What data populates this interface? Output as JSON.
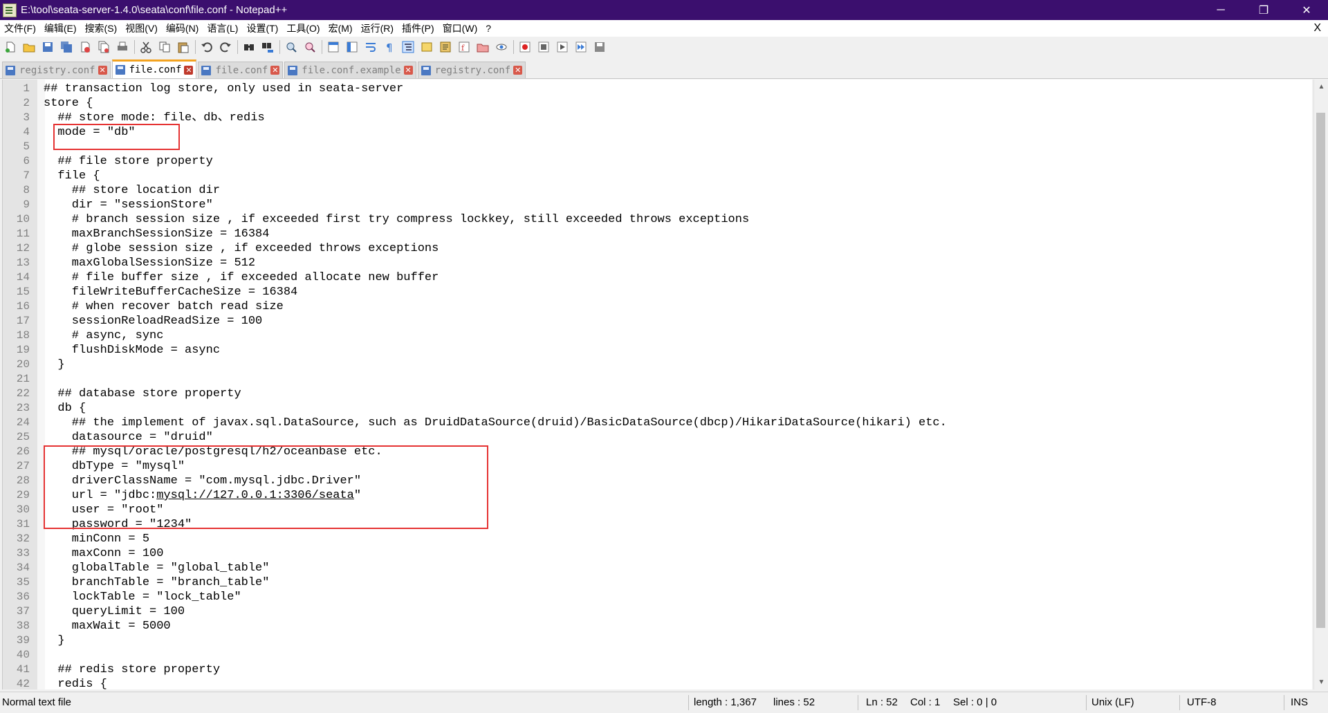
{
  "window": {
    "title": "E:\\tool\\seata-server-1.4.0\\seata\\conf\\file.conf - Notepad++",
    "minimize": "─",
    "restore": "❐",
    "close": "✕"
  },
  "menu": {
    "items": [
      "文件(F)",
      "编辑(E)",
      "搜索(S)",
      "视图(V)",
      "编码(N)",
      "语言(L)",
      "设置(T)",
      "工具(O)",
      "宏(M)",
      "运行(R)",
      "插件(P)",
      "窗口(W)",
      "?"
    ],
    "close": "X"
  },
  "toolbar": {
    "icons": [
      "new-file-icon",
      "open-file-icon",
      "save-icon",
      "save-all-icon",
      "close-icon",
      "close-all-icon",
      "print-icon",
      "cut-icon",
      "copy-icon",
      "paste-icon",
      "undo-icon",
      "redo-icon",
      "find-icon",
      "replace-icon",
      "zoom-in-icon",
      "zoom-out-icon",
      "sync-vertical-icon",
      "sync-horizontal-icon",
      "word-wrap-icon",
      "show-all-chars-icon",
      "indent-guide-icon",
      "udl-icon",
      "doc-map-icon",
      "function-list-icon",
      "folder-workspace-icon",
      "monitor-icon",
      "record-macro-icon",
      "stop-record-icon",
      "play-macro-icon",
      "run-macro-multiple-icon",
      "save-macro-icon"
    ]
  },
  "tabs": [
    {
      "label": "registry.conf",
      "active": false
    },
    {
      "label": "file.conf",
      "active": true
    },
    {
      "label": "file.conf",
      "active": false
    },
    {
      "label": "file.conf.example",
      "active": false
    },
    {
      "label": "registry.conf",
      "active": false
    }
  ],
  "editor": {
    "lines": [
      "## transaction log store, only used in seata-server",
      "store {",
      "  ## store mode: file、db、redis",
      "  mode = \"db\"",
      "",
      "  ## file store property",
      "  file {",
      "    ## store location dir",
      "    dir = \"sessionStore\"",
      "    # branch session size , if exceeded first try compress lockkey, still exceeded throws exceptions",
      "    maxBranchSessionSize = 16384",
      "    # globe session size , if exceeded throws exceptions",
      "    maxGlobalSessionSize = 512",
      "    # file buffer size , if exceeded allocate new buffer",
      "    fileWriteBufferCacheSize = 16384",
      "    # when recover batch read size",
      "    sessionReloadReadSize = 100",
      "    # async, sync",
      "    flushDiskMode = async",
      "  }",
      "",
      "  ## database store property",
      "  db {",
      "    ## the implement of javax.sql.DataSource, such as DruidDataSource(druid)/BasicDataSource(dbcp)/HikariDataSource(hikari) etc.",
      "    datasource = \"druid\"",
      "    ## mysql/oracle/postgresql/h2/oceanbase etc.",
      "    dbType = \"mysql\"",
      "    driverClassName = \"com.mysql.jdbc.Driver\"",
      "    url = \"jdbc:mysql://127.0.0.1:3306/seata\"",
      "    user = \"root\"",
      "    password = \"1234\"",
      "    minConn = 5",
      "    maxConn = 100",
      "    globalTable = \"global_table\"",
      "    branchTable = \"branch_table\"",
      "    lockTable = \"lock_table\"",
      "    queryLimit = 100",
      "    maxWait = 5000",
      "  }",
      "",
      "  ## redis store property",
      "  redis {"
    ],
    "url_prefix": "    url = \"jdbc:",
    "url_link": "mysql://127.0.0.1:3306/seata",
    "url_suffix": "\""
  },
  "status": {
    "file_type": "Normal text file",
    "length": "length : 1,367",
    "lines": "lines : 52",
    "ln": "Ln : 52",
    "col": "Col : 1",
    "sel": "Sel : 0 | 0",
    "eol": "Unix (LF)",
    "encoding": "UTF-8",
    "mode": "INS"
  }
}
